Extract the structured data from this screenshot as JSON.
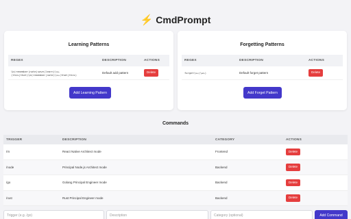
{
  "app": {
    "title": "CmdPrompt",
    "logo_icon": "lightning-bolt"
  },
  "learning": {
    "title": "Learning Patterns",
    "columns": [
      "REGEX",
      "DESCRIPTION",
      "ACTIONS"
    ],
    "rows": [
      {
        "regex": "\\b(remember|note|save|learn)\\s+(this|that)\\b(remember|note)\\s+(that|this)",
        "description": "Default add pattern",
        "action": "Delete"
      }
    ],
    "add_label": "Add Learning Pattern"
  },
  "forgetting": {
    "title": "Forgetting Patterns",
    "columns": [
      "REGEX",
      "DESCRIPTION",
      "ACTIONS"
    ],
    "rows": [
      {
        "regex": "forget\\s+(\\w+)",
        "description": "Default forget pattern",
        "action": "Delete"
      }
    ],
    "add_label": "Add Forget Pattern"
  },
  "commands": {
    "title": "Commands",
    "columns": [
      "TRIGGER",
      "DESCRIPTION",
      "CATEGORY",
      "ACTIONS"
    ],
    "rows": [
      {
        "trigger": "/rn",
        "description": "React Native Architect mode",
        "category": "Frontend",
        "action": "Delete"
      },
      {
        "trigger": "/node",
        "description": "Principal Node.js Architect mode",
        "category": "Backend",
        "action": "Delete"
      },
      {
        "trigger": "/go",
        "description": "Golang Principal Engineer mode",
        "category": "Backend",
        "action": "Delete"
      },
      {
        "trigger": "/rust",
        "description": "Rust Principal Engineer mode",
        "category": "Backend",
        "action": "Delete"
      }
    ],
    "form": {
      "trigger_placeholder": "Trigger (e.g. /go)",
      "description_placeholder": "Description",
      "category_placeholder": "Category (optional)",
      "add_label": "Add Command"
    }
  },
  "colors": {
    "accent": "#4338ca",
    "danger": "#e53e3e",
    "logo": "#f5b301"
  }
}
